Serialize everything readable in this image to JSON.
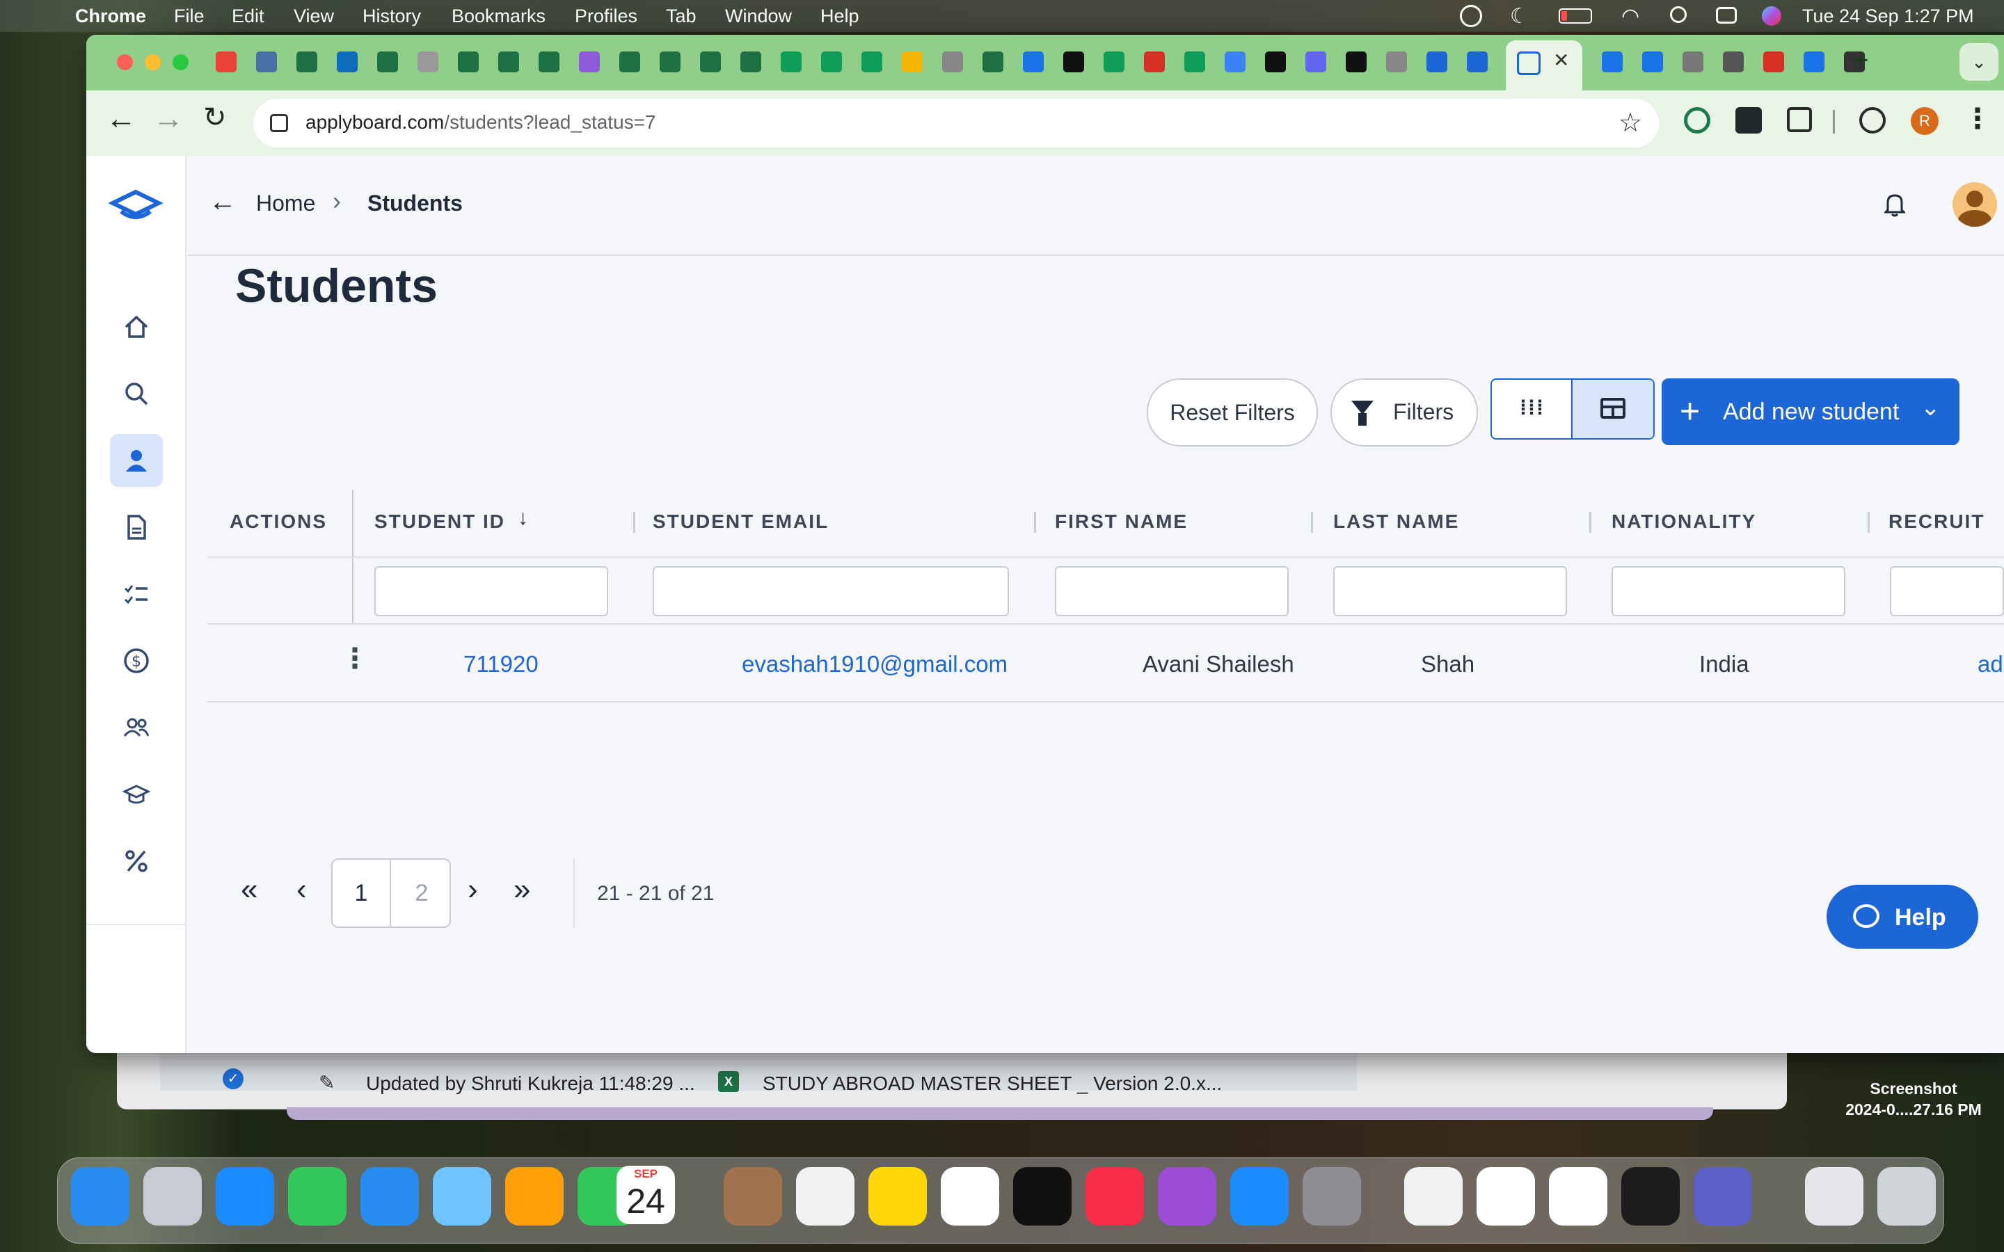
{
  "menubar": {
    "app": "Chrome",
    "items": [
      "File",
      "Edit",
      "View",
      "History",
      "Bookmarks",
      "Profiles",
      "Tab",
      "Window",
      "Help"
    ],
    "clock": "Tue 24 Sep  1:27 PM"
  },
  "browser": {
    "url_domain": "applyboard.com",
    "url_path": "/students?lead_status=7",
    "active_tab_close": "✕",
    "new_tab": "+",
    "profile_initial": "R"
  },
  "page": {
    "breadcrumb": {
      "home": "Home",
      "current": "Students"
    },
    "title": "Students",
    "buttons": {
      "reset_filters": "Reset Filters",
      "filters": "Filters",
      "add_new_student": "Add new student"
    },
    "table": {
      "columns": [
        "ACTIONS",
        "STUDENT ID",
        "STUDENT EMAIL",
        "FIRST NAME",
        "LAST NAME",
        "NATIONALITY",
        "RECRUIT"
      ],
      "rows": [
        {
          "student_id": "711920",
          "email": "evashah1910@gmail.com",
          "first_name": "Avani Shailesh",
          "last_name": "Shah",
          "nationality": "India",
          "recruiter": "admissio"
        }
      ]
    },
    "pagination": {
      "page1": "1",
      "page2": "2",
      "range": "21 - 21 of 21"
    },
    "help": "Help"
  },
  "desktop": {
    "bg_window_text1": "Updated by Shruti Kukreja 11:48:29 ...",
    "bg_window_text2": "STUDY ABROAD MASTER SHEET _ Version 2.0.x...",
    "screenshot_label1": "Screenshot",
    "screenshot_label2": "2024-0....27.16 PM",
    "calendar_month": "SEP",
    "calendar_day": "24"
  }
}
